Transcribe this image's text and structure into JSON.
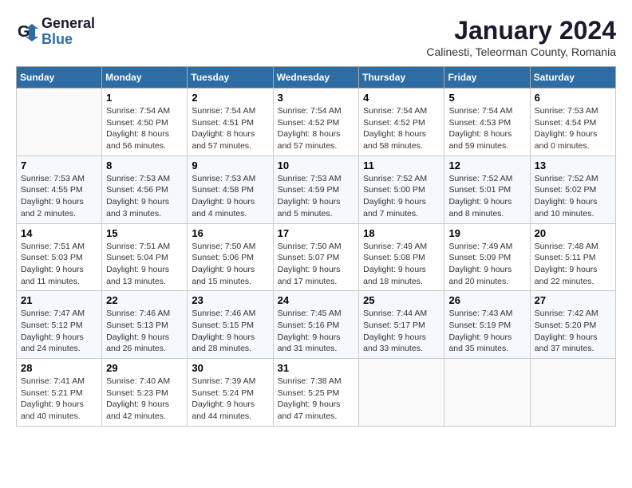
{
  "header": {
    "logo_line1": "General",
    "logo_line2": "Blue",
    "month_year": "January 2024",
    "location": "Calinesti, Teleorman County, Romania"
  },
  "weekdays": [
    "Sunday",
    "Monday",
    "Tuesday",
    "Wednesday",
    "Thursday",
    "Friday",
    "Saturday"
  ],
  "weeks": [
    [
      {
        "day": "",
        "info": ""
      },
      {
        "day": "1",
        "info": "Sunrise: 7:54 AM\nSunset: 4:50 PM\nDaylight: 8 hours\nand 56 minutes."
      },
      {
        "day": "2",
        "info": "Sunrise: 7:54 AM\nSunset: 4:51 PM\nDaylight: 8 hours\nand 57 minutes."
      },
      {
        "day": "3",
        "info": "Sunrise: 7:54 AM\nSunset: 4:52 PM\nDaylight: 8 hours\nand 57 minutes."
      },
      {
        "day": "4",
        "info": "Sunrise: 7:54 AM\nSunset: 4:52 PM\nDaylight: 8 hours\nand 58 minutes."
      },
      {
        "day": "5",
        "info": "Sunrise: 7:54 AM\nSunset: 4:53 PM\nDaylight: 8 hours\nand 59 minutes."
      },
      {
        "day": "6",
        "info": "Sunrise: 7:53 AM\nSunset: 4:54 PM\nDaylight: 9 hours\nand 0 minutes."
      }
    ],
    [
      {
        "day": "7",
        "info": "Sunrise: 7:53 AM\nSunset: 4:55 PM\nDaylight: 9 hours\nand 2 minutes."
      },
      {
        "day": "8",
        "info": "Sunrise: 7:53 AM\nSunset: 4:56 PM\nDaylight: 9 hours\nand 3 minutes."
      },
      {
        "day": "9",
        "info": "Sunrise: 7:53 AM\nSunset: 4:58 PM\nDaylight: 9 hours\nand 4 minutes."
      },
      {
        "day": "10",
        "info": "Sunrise: 7:53 AM\nSunset: 4:59 PM\nDaylight: 9 hours\nand 5 minutes."
      },
      {
        "day": "11",
        "info": "Sunrise: 7:52 AM\nSunset: 5:00 PM\nDaylight: 9 hours\nand 7 minutes."
      },
      {
        "day": "12",
        "info": "Sunrise: 7:52 AM\nSunset: 5:01 PM\nDaylight: 9 hours\nand 8 minutes."
      },
      {
        "day": "13",
        "info": "Sunrise: 7:52 AM\nSunset: 5:02 PM\nDaylight: 9 hours\nand 10 minutes."
      }
    ],
    [
      {
        "day": "14",
        "info": "Sunrise: 7:51 AM\nSunset: 5:03 PM\nDaylight: 9 hours\nand 11 minutes."
      },
      {
        "day": "15",
        "info": "Sunrise: 7:51 AM\nSunset: 5:04 PM\nDaylight: 9 hours\nand 13 minutes."
      },
      {
        "day": "16",
        "info": "Sunrise: 7:50 AM\nSunset: 5:06 PM\nDaylight: 9 hours\nand 15 minutes."
      },
      {
        "day": "17",
        "info": "Sunrise: 7:50 AM\nSunset: 5:07 PM\nDaylight: 9 hours\nand 17 minutes."
      },
      {
        "day": "18",
        "info": "Sunrise: 7:49 AM\nSunset: 5:08 PM\nDaylight: 9 hours\nand 18 minutes."
      },
      {
        "day": "19",
        "info": "Sunrise: 7:49 AM\nSunset: 5:09 PM\nDaylight: 9 hours\nand 20 minutes."
      },
      {
        "day": "20",
        "info": "Sunrise: 7:48 AM\nSunset: 5:11 PM\nDaylight: 9 hours\nand 22 minutes."
      }
    ],
    [
      {
        "day": "21",
        "info": "Sunrise: 7:47 AM\nSunset: 5:12 PM\nDaylight: 9 hours\nand 24 minutes."
      },
      {
        "day": "22",
        "info": "Sunrise: 7:46 AM\nSunset: 5:13 PM\nDaylight: 9 hours\nand 26 minutes."
      },
      {
        "day": "23",
        "info": "Sunrise: 7:46 AM\nSunset: 5:15 PM\nDaylight: 9 hours\nand 28 minutes."
      },
      {
        "day": "24",
        "info": "Sunrise: 7:45 AM\nSunset: 5:16 PM\nDaylight: 9 hours\nand 31 minutes."
      },
      {
        "day": "25",
        "info": "Sunrise: 7:44 AM\nSunset: 5:17 PM\nDaylight: 9 hours\nand 33 minutes."
      },
      {
        "day": "26",
        "info": "Sunrise: 7:43 AM\nSunset: 5:19 PM\nDaylight: 9 hours\nand 35 minutes."
      },
      {
        "day": "27",
        "info": "Sunrise: 7:42 AM\nSunset: 5:20 PM\nDaylight: 9 hours\nand 37 minutes."
      }
    ],
    [
      {
        "day": "28",
        "info": "Sunrise: 7:41 AM\nSunset: 5:21 PM\nDaylight: 9 hours\nand 40 minutes."
      },
      {
        "day": "29",
        "info": "Sunrise: 7:40 AM\nSunset: 5:23 PM\nDaylight: 9 hours\nand 42 minutes."
      },
      {
        "day": "30",
        "info": "Sunrise: 7:39 AM\nSunset: 5:24 PM\nDaylight: 9 hours\nand 44 minutes."
      },
      {
        "day": "31",
        "info": "Sunrise: 7:38 AM\nSunset: 5:25 PM\nDaylight: 9 hours\nand 47 minutes."
      },
      {
        "day": "",
        "info": ""
      },
      {
        "day": "",
        "info": ""
      },
      {
        "day": "",
        "info": ""
      }
    ]
  ]
}
